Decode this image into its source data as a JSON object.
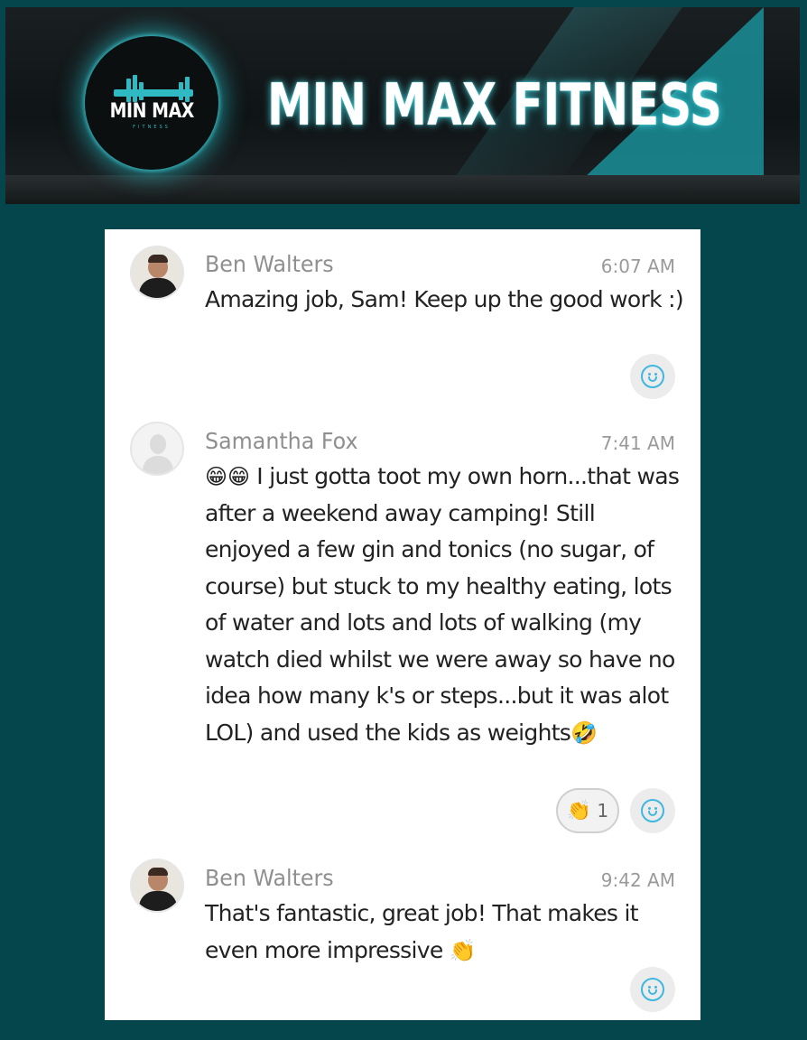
{
  "banner": {
    "logo_text": "MIN MAX",
    "logo_sub": "FITNESS",
    "title": "MIN MAX FITNESS"
  },
  "messages": [
    {
      "sender": "Ben Walters",
      "time": "6:07 AM",
      "text": "Amazing job, Sam! Keep up the good work :)",
      "avatar": "ben-walters-avatar",
      "reactions": []
    },
    {
      "sender": "Samantha Fox",
      "time": "7:41 AM",
      "leading_emoji": "😁😁",
      "text": " I just gotta toot my own horn...that was after a weekend away camping! Still enjoyed a few gin and tonics (no sugar, of course) but stuck to my healthy eating, lots of water and lots and lots of walking (my watch died whilst we were away so have no idea how many k's or steps...but it was alot LOL) and used the kids as weights",
      "trailing_emoji": "🤣",
      "avatar": "default-avatar",
      "reactions": [
        {
          "emoji": "👏",
          "count": "1"
        }
      ]
    },
    {
      "sender": "Ben Walters",
      "time": "9:42 AM",
      "text": "That's fantastic, great job! That makes it even more impressive ",
      "trailing_emoji": "👏",
      "avatar": "ben-walters-avatar",
      "reactions": []
    }
  ],
  "colors": {
    "background": "#05454c",
    "accent": "#2fb9c3",
    "reaction_icon": "#3fb7e0"
  }
}
